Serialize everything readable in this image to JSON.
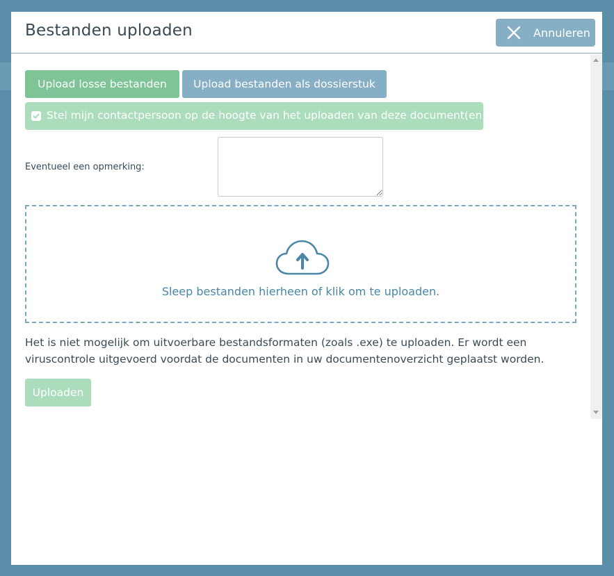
{
  "modal": {
    "title": "Bestanden uploaden",
    "cancel_label": "Annuleren"
  },
  "tabs": {
    "loose_files": "Upload losse bestanden",
    "dossier_item": "Upload bestanden als dossierstuk"
  },
  "notify": {
    "checked": true,
    "label": "Stel mijn contactpersoon op de hoogte van het uploaden van deze document(en)."
  },
  "remark": {
    "label": "Eventueel een opmerking:",
    "value": ""
  },
  "dropzone": {
    "icon": "cloud-upload-icon",
    "text": "Sleep bestanden hierheen of klik om te uploaden."
  },
  "info_text": "Het is niet mogelijk om uitvoerbare bestandsformaten (zoals .exe) te uploaden. Er wordt een viruscontrole uitgevoerd voordat de documenten in uw documentenoverzicht geplaatst worden.",
  "upload_button": "Uploaden",
  "colors": {
    "green": "#7ec497",
    "green_light": "#abdcbc",
    "blue": "#86aec5",
    "backdrop": "#5b8fa9"
  }
}
